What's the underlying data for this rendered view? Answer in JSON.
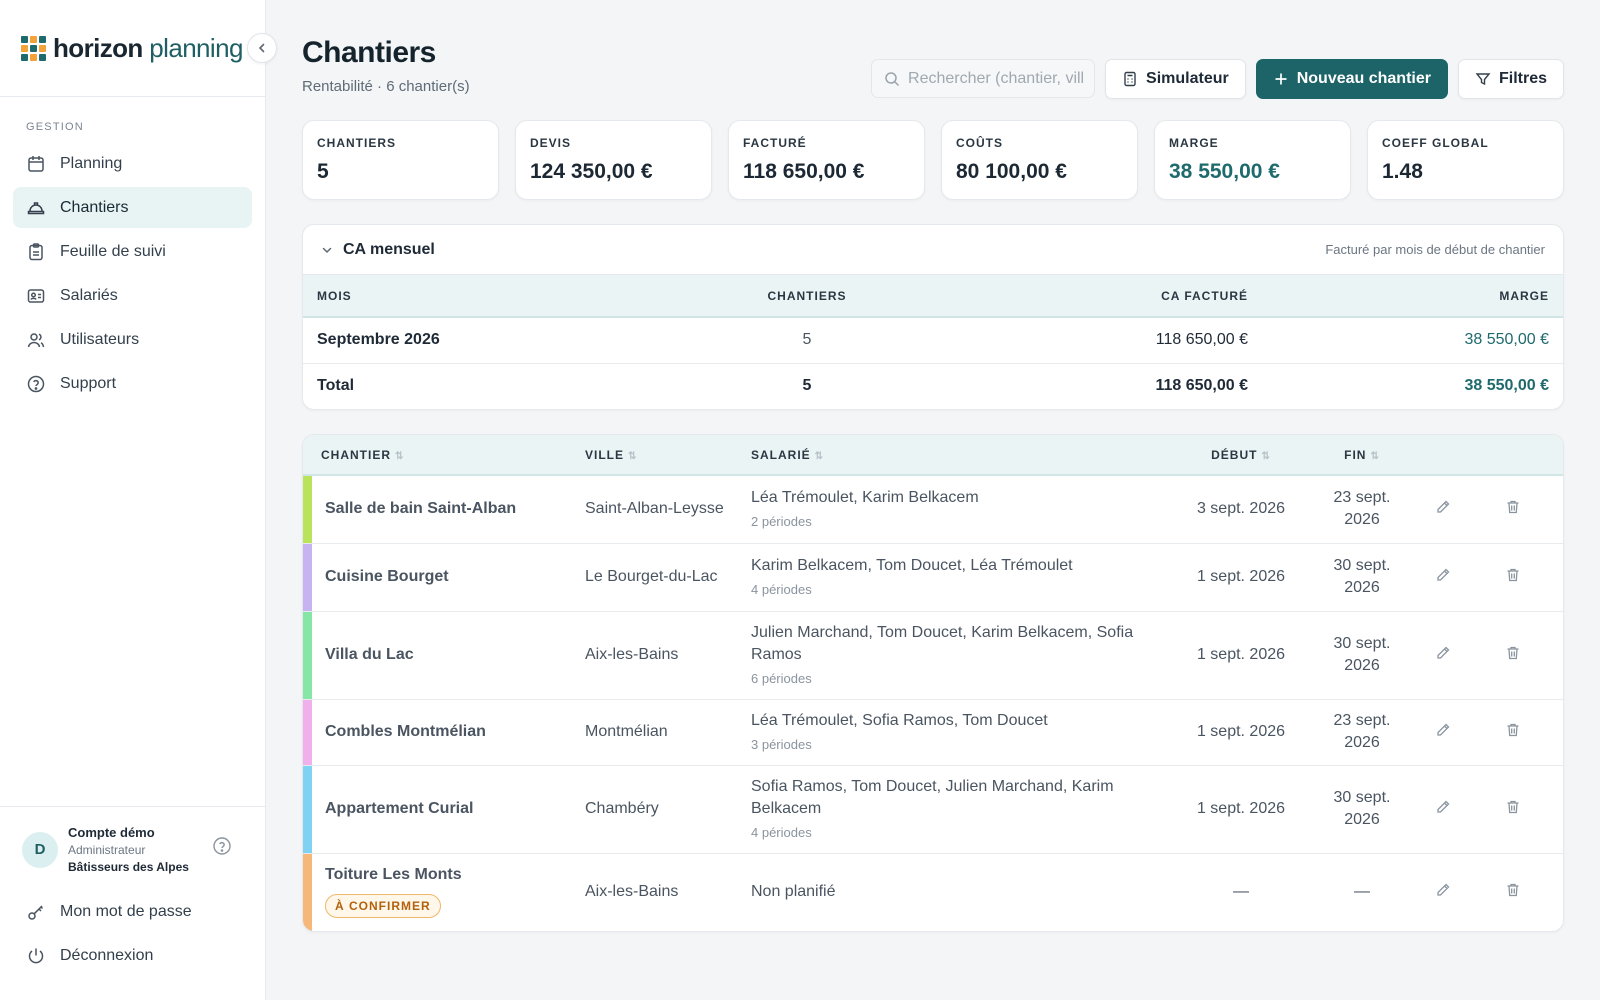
{
  "brand": {
    "bold": "horizon",
    "light": "planning"
  },
  "sidebar": {
    "group": "GESTION",
    "items": [
      {
        "label": "Planning",
        "icon": "calendar-icon"
      },
      {
        "label": "Chantiers",
        "icon": "helmet-icon"
      },
      {
        "label": "Feuille de suivi",
        "icon": "clipboard-icon"
      },
      {
        "label": "Salariés",
        "icon": "id-card-icon"
      },
      {
        "label": "Utilisateurs",
        "icon": "users-icon"
      },
      {
        "label": "Support",
        "icon": "help-circle-icon"
      }
    ],
    "active": "Chantiers",
    "account": {
      "initial": "D",
      "name": "Compte démo",
      "role": "Administrateur",
      "org": "Bâtisseurs des Alpes"
    },
    "password_label": "Mon mot de passe",
    "logout_label": "Déconnexion"
  },
  "header": {
    "title": "Chantiers",
    "subtitle": "Rentabilité · 6 chantier(s)",
    "search_placeholder": "Rechercher (chantier, vill",
    "simulator_label": "Simulateur",
    "new_label": "Nouveau chantier",
    "filters_label": "Filtres"
  },
  "kpis": [
    {
      "label": "CHANTIERS",
      "value": "5",
      "accent": false
    },
    {
      "label": "DEVIS",
      "value": "124 350,00 €",
      "accent": false
    },
    {
      "label": "FACTURÉ",
      "value": "118 650,00 €",
      "accent": false
    },
    {
      "label": "COÛTS",
      "value": "80 100,00 €",
      "accent": false
    },
    {
      "label": "MARGE",
      "value": "38 550,00 €",
      "accent": true
    },
    {
      "label": "COEFF GLOBAL",
      "value": "1.48",
      "accent": false
    }
  ],
  "ca": {
    "title": "CA mensuel",
    "note": "Facturé par mois de début de chantier",
    "headers": {
      "mois": "MOIS",
      "chantiers": "CHANTIERS",
      "ca": "CA FACTURÉ",
      "marge": "MARGE"
    },
    "row": {
      "mois": "Septembre 2026",
      "chantiers": "5",
      "ca": "118 650,00 €",
      "marge": "38 550,00 €"
    },
    "total": {
      "mois": "Total",
      "chantiers": "5",
      "ca": "118 650,00 €",
      "marge": "38 550,00 €"
    }
  },
  "jobs": {
    "headers": {
      "chantier": "CHANTIER",
      "ville": "VILLE",
      "salarie": "SALARIÉ",
      "debut": "DÉBUT",
      "fin": "FIN"
    },
    "rows": [
      {
        "name": "Salle de bain Saint-Alban",
        "color": "#b8e35a",
        "ville": "Saint-Alban-Leysse",
        "salaries": "Léa Trémoulet, Karim Belkacem",
        "periodes": "2 périodes",
        "debut": "3 sept. 2026",
        "fin": "23 sept. 2026",
        "badge": ""
      },
      {
        "name": "Cuisine Bourget",
        "color": "#c6b3f0",
        "ville": "Le Bourget-du-Lac",
        "salaries": "Karim Belkacem, Tom Doucet, Léa Trémoulet",
        "periodes": "4 périodes",
        "debut": "1 sept. 2026",
        "fin": "30 sept. 2026",
        "badge": ""
      },
      {
        "name": "Villa du Lac",
        "color": "#86e6a6",
        "ville": "Aix-les-Bains",
        "salaries": "Julien Marchand, Tom Doucet, Karim Belkacem, Sofia Ramos",
        "periodes": "6 périodes",
        "debut": "1 sept. 2026",
        "fin": "30 sept. 2026",
        "badge": ""
      },
      {
        "name": "Combles Montmélian",
        "color": "#f0b0ec",
        "ville": "Montmélian",
        "salaries": "Léa Trémoulet, Sofia Ramos, Tom Doucet",
        "periodes": "3 périodes",
        "debut": "1 sept. 2026",
        "fin": "23 sept. 2026",
        "badge": ""
      },
      {
        "name": "Appartement Curial",
        "color": "#7fd2f2",
        "ville": "Chambéry",
        "salaries": "Sofia Ramos, Tom Doucet, Julien Marchand, Karim Belkacem",
        "periodes": "4 périodes",
        "debut": "1 sept. 2026",
        "fin": "30 sept. 2026",
        "badge": ""
      },
      {
        "name": "Toiture Les Monts",
        "color": "#f5b77a",
        "ville": "Aix-les-Bains",
        "salaries": "Non planifié",
        "periodes": "",
        "debut": "—",
        "fin": "—",
        "badge": "À CONFIRMER"
      }
    ]
  },
  "colors": {
    "primary": "#1c6468",
    "accent": "#1f6a6d",
    "table_header": "#eaf4f5"
  }
}
